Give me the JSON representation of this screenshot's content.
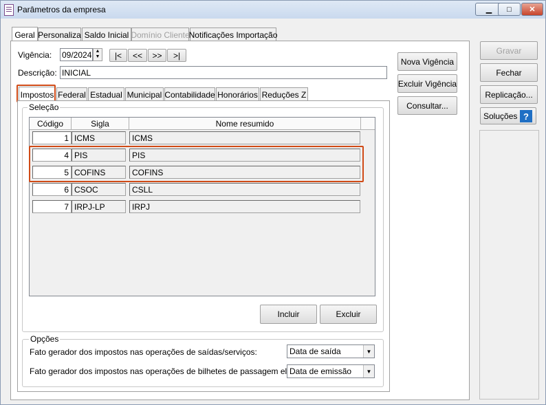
{
  "window": {
    "title": "Parâmetros da empresa"
  },
  "main_tabs": [
    "Geral",
    "Personaliza",
    "Saldo Inicial",
    "Domínio Cliente",
    "Notificações Importação"
  ],
  "vigencia": {
    "label": "Vigência:",
    "value": "09/2024",
    "nav": [
      "|<",
      "<<",
      ">>",
      ">|"
    ]
  },
  "descricao": {
    "label": "Descrição:",
    "value": "INICIAL"
  },
  "center_buttons": [
    "Nova Vigência",
    "Excluir Vigência",
    "Consultar..."
  ],
  "right_buttons": {
    "gravar": "Gravar",
    "fechar": "Fechar",
    "replicacao": "Replicação...",
    "solucoes": "Soluções",
    "help": "?"
  },
  "sub_tabs": [
    "Impostos",
    "Federal",
    "Estadual",
    "Municipal",
    "Contabilidade",
    "Honorários",
    "Reduções Z"
  ],
  "selecao": {
    "title": "Seleção",
    "columns": [
      "Código",
      "Sigla",
      "Nome resumido"
    ],
    "rows": [
      {
        "codigo": "1",
        "sigla": "ICMS",
        "nome": "ICMS"
      },
      {
        "codigo": "4",
        "sigla": "PIS",
        "nome": "PIS"
      },
      {
        "codigo": "5",
        "sigla": "COFINS",
        "nome": "COFINS"
      },
      {
        "codigo": "6",
        "sigla": "CSOC",
        "nome": "CSLL"
      },
      {
        "codigo": "7",
        "sigla": "IRPJ-LP",
        "nome": "IRPJ"
      }
    ],
    "incluir": "Incluir",
    "excluir": "Excluir"
  },
  "opcoes": {
    "title": "Opções",
    "fato_saidas_label": "Fato gerador dos impostos nas operações de saídas/serviços:",
    "fato_saidas_value": "Data de saída",
    "fato_bilhetes_label": "Fato gerador dos impostos nas operações de bilhetes de passagem eletrônico:",
    "fato_bilhetes_value": "Data de emissão"
  },
  "colors": {
    "highlight": "#d04a16"
  }
}
